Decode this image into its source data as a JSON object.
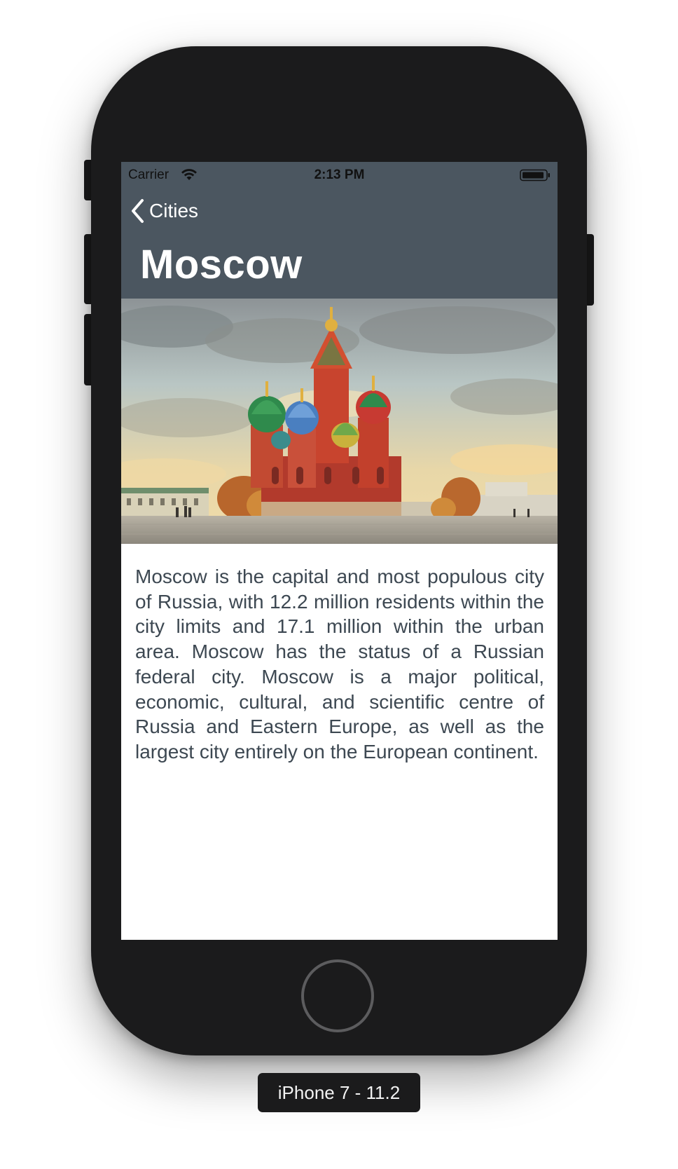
{
  "status_bar": {
    "carrier": "Carrier",
    "time": "2:13 PM",
    "wifi_icon": "wifi-icon",
    "battery_icon": "battery-icon"
  },
  "navigation": {
    "back_label": "Cities",
    "back_icon": "chevron-left-icon",
    "title": "Moscow",
    "bar_color": "#4b5660"
  },
  "content": {
    "image_subject": "Saint Basil's Cathedral",
    "description": "Moscow is the capital and most populous city of Russia, with 12.2 million residents within the city limits and 17.1 million within the urban area. Moscow has the status of a Russian federal city. Moscow is a major political, economic, cultural, and scientific centre of Russia and Eastern Europe, as well as the largest city entirely on the European continent.",
    "text_color": "#3d4852"
  },
  "device": {
    "label": "iPhone 7 - 11.2"
  }
}
